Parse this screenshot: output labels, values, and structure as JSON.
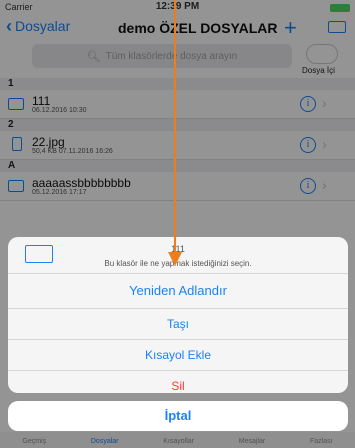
{
  "status_bar": {
    "carrier": "Carrier",
    "time": "12:39 PM"
  },
  "nav": {
    "back_label": "Dosyalar",
    "title": "demo ÖZEL DOSYALAR",
    "add_symbol": "+"
  },
  "search": {
    "placeholder": "Tüm klasörlerde dosya arayın"
  },
  "toggle": {
    "label": "Dosya İçi"
  },
  "sections": [
    {
      "header": "1",
      "items": [
        {
          "name": "111",
          "meta": "06.12.2016 10:30",
          "icon": "folder-icon"
        }
      ]
    },
    {
      "header": "2",
      "items": [
        {
          "name": "22.jpg",
          "meta": "50,4 KB  07.11.2016 16:26",
          "icon": "file-icon"
        }
      ]
    },
    {
      "header": "A",
      "items": [
        {
          "name": "aaaaassbbbbbbbb",
          "meta": "05.12.2016 17:17",
          "icon": "folder-icon"
        }
      ]
    }
  ],
  "action_sheet": {
    "title": "111",
    "message": "Bu klasör ile ne yapmak istediğinizi seçin.",
    "actions": [
      "Yeniden Adlandır",
      "Taşı",
      "Kısayol Ekle",
      "Sil"
    ],
    "cancel": "İptal"
  },
  "tab_bar": {
    "tabs": [
      "Geçmiş",
      "Dosyalar",
      "Kısayollar",
      "Mesajlar",
      "Fazlası"
    ]
  },
  "colors": {
    "accent": "#1a82f7",
    "destructive": "#ff3b30",
    "annotation_arrow": "#f07c1c"
  }
}
